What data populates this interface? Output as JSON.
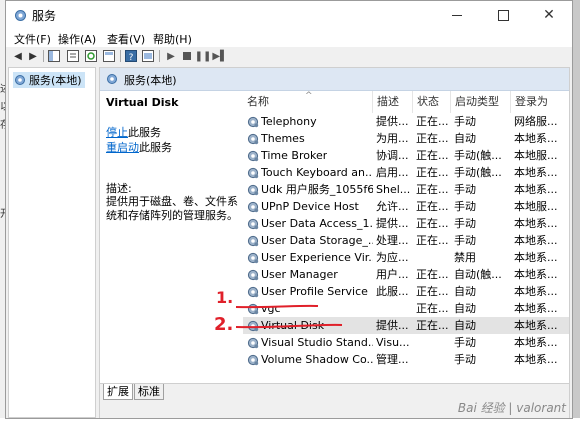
{
  "window": {
    "title": "服务",
    "menus": [
      "文件(F)",
      "操作(A)",
      "查看(V)",
      "帮助(H)"
    ]
  },
  "tree": {
    "root": "服务(本地)"
  },
  "pane": {
    "header": "服务(本地)",
    "service_name": "Virtual Disk",
    "stop_link": "停止",
    "stop_rest": "此服务",
    "restart_link": "重启动",
    "restart_rest": "此服务",
    "desc_label": "描述:",
    "desc_text": "提供用于磁盘、卷、文件系统和存储阵列的管理服务。"
  },
  "table": {
    "headers": [
      "名称",
      "描述",
      "状态",
      "启动类型",
      "登录为"
    ],
    "rows": [
      {
        "name": "Telephony",
        "desc": "提供...",
        "status": "正在...",
        "start": "手动",
        "logon": "网络服..."
      },
      {
        "name": "Themes",
        "desc": "为用...",
        "status": "正在...",
        "start": "自动",
        "logon": "本地系..."
      },
      {
        "name": "Time Broker",
        "desc": "协调...",
        "status": "正在...",
        "start": "手动(触...",
        "logon": "本地服..."
      },
      {
        "name": "Touch Keyboard an...",
        "desc": "启用...",
        "status": "正在...",
        "start": "手动(触...",
        "logon": "本地系..."
      },
      {
        "name": "Udk 用户服务_1055f6",
        "desc": "Shel...",
        "status": "正在...",
        "start": "手动",
        "logon": "本地系..."
      },
      {
        "name": "UPnP Device Host",
        "desc": "允许...",
        "status": "正在...",
        "start": "手动",
        "logon": "本地服..."
      },
      {
        "name": "User Data Access_1...",
        "desc": "提供...",
        "status": "正在...",
        "start": "手动",
        "logon": "本地系..."
      },
      {
        "name": "User Data Storage_...",
        "desc": "处理...",
        "status": "正在...",
        "start": "手动",
        "logon": "本地系..."
      },
      {
        "name": "User Experience Vir...",
        "desc": "为应...",
        "status": "",
        "start": "禁用",
        "logon": "本地系..."
      },
      {
        "name": "User Manager",
        "desc": "用户...",
        "status": "正在...",
        "start": "自动(触...",
        "logon": "本地系..."
      },
      {
        "name": "User Profile Service",
        "desc": "此服...",
        "status": "正在...",
        "start": "自动",
        "logon": "本地系..."
      },
      {
        "name": "vgc",
        "desc": "",
        "status": "正在...",
        "start": "自动",
        "logon": "本地系..."
      },
      {
        "name": "Virtual Disk",
        "desc": "提供...",
        "status": "正在...",
        "start": "自动",
        "logon": "本地系..."
      },
      {
        "name": "Visual Studio Stand...",
        "desc": "Visu...",
        "status": "",
        "start": "手动",
        "logon": "本地系..."
      },
      {
        "name": "Volume Shadow Co...",
        "desc": "管理...",
        "status": "",
        "start": "手动",
        "logon": "本地系..."
      }
    ]
  },
  "tabs": [
    "扩展",
    "标准"
  ],
  "annotations": [
    "1.",
    "2."
  ],
  "watermark": "Bai 经验 | valorant",
  "colors": {
    "link": "#0066cc",
    "selection": "#cce4f7",
    "annotation": "#e0202a",
    "header_bg": "#dde7f3"
  },
  "icons": [
    "services-icon",
    "gear-icon",
    "back-arrow-icon",
    "forward-arrow-icon",
    "play-icon",
    "stop-icon",
    "pause-icon",
    "restart-icon"
  ]
}
